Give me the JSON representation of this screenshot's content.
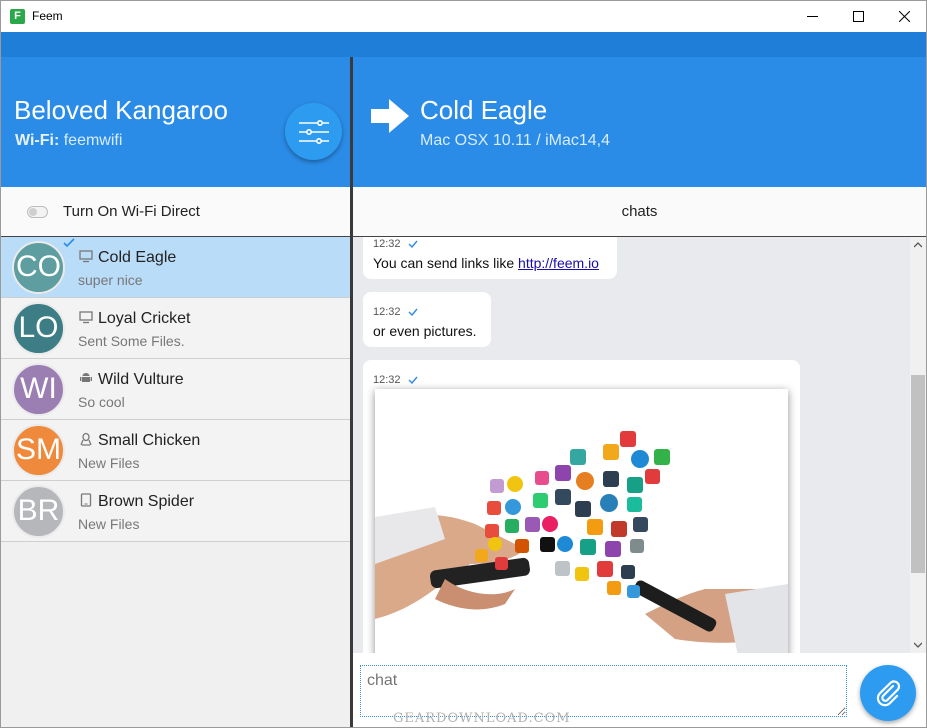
{
  "window": {
    "title": "Feem"
  },
  "local_device": {
    "name": "Beloved Kangaroo",
    "wifi_label": "Wi-Fi:",
    "wifi_name": "feemwifi"
  },
  "toolbar": {
    "wifi_direct_label": "Turn On Wi-Fi Direct",
    "wifi_direct_on": false
  },
  "peers": [
    {
      "initials": "CO",
      "name": "Cold Eagle",
      "status": "super nice",
      "device": "desktop-icon",
      "color": "#5f9ea0",
      "selected": true
    },
    {
      "initials": "LO",
      "name": "Loyal Cricket",
      "status": "Sent Some Files.",
      "device": "desktop-icon",
      "color": "#3d7d86",
      "selected": false
    },
    {
      "initials": "WI",
      "name": "Wild Vulture",
      "status": "So cool",
      "device": "android-icon",
      "color": "#9b7fb3",
      "selected": false
    },
    {
      "initials": "SM",
      "name": "Small Chicken",
      "status": "New Files",
      "device": "linux-icon",
      "color": "#ef8a3c",
      "selected": false
    },
    {
      "initials": "BR",
      "name": "Brown Spider",
      "status": "New Files",
      "device": "tablet-icon",
      "color": "#b5b7bb",
      "selected": false
    }
  ],
  "peer_header": {
    "name": "Cold Eagle",
    "platform": "Mac OSX 10.11 / iMac14,4"
  },
  "tabs": {
    "chats": "chats"
  },
  "messages": [
    {
      "time": "12:32",
      "text": "You can send links like ",
      "link": "http://feem.io"
    },
    {
      "time": "12:32",
      "text": "or even pictures."
    },
    {
      "time": "12:32",
      "image": "hands-with-phones-app-icons"
    }
  ],
  "composer": {
    "placeholder": "chat"
  },
  "watermark": "GEARDOWNLOAD.COM",
  "colors": {
    "accent": "#2b8ce8",
    "dark_accent": "#1f7ed8",
    "selected_row": "#b9dcf9"
  }
}
